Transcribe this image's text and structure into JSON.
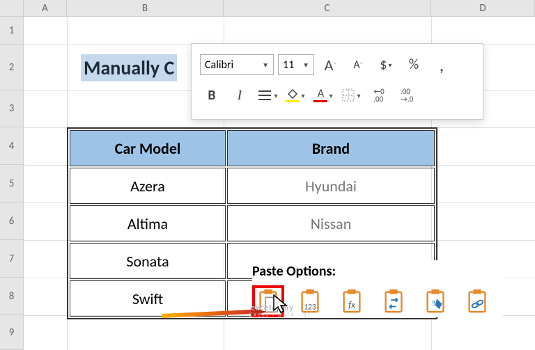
{
  "columns": {
    "A": "A",
    "B": "B",
    "C": "C",
    "D": "D"
  },
  "rows": {
    "1": "1",
    "2": "2",
    "3": "3",
    "4": "4",
    "5": "5",
    "6": "6",
    "7": "7",
    "8": "8",
    "9": "9"
  },
  "title": "Manually C",
  "table": {
    "headers": {
      "model": "Car Model",
      "brand": "Brand"
    },
    "data": [
      {
        "model": "Azera",
        "brand": "Hyundai"
      },
      {
        "model": "Altima",
        "brand": "Nissan"
      },
      {
        "model": "Sonata",
        "brand": ""
      },
      {
        "model": "Swift",
        "brand": ""
      }
    ]
  },
  "minitoolbar": {
    "font": "Calibri",
    "size": "11",
    "grow": "A",
    "shrink": "A",
    "currency": "$",
    "percent": "%",
    "comma": ",",
    "bold": "B",
    "italic": "I",
    "inc": ".00",
    "inc2": "→.0",
    "dec": ".00",
    "dec2": "←.0"
  },
  "paste": {
    "title": "Paste Options:"
  },
  "watermark": {
    "a": "exceldemy",
    "b": "EXCEL · DATA · BI"
  }
}
